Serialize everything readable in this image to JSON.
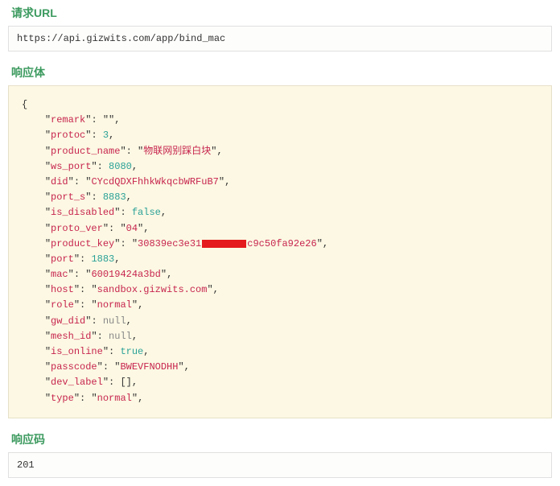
{
  "sections": {
    "request_url_title": "请求URL",
    "response_body_title": "响应体",
    "response_code_title": "响应码"
  },
  "request_url": "https://api.gizwits.com/app/bind_mac",
  "response_code": "201",
  "response_body": {
    "remark": "",
    "protoc": 3,
    "product_name": "物联网别踩白块",
    "ws_port": 8080,
    "did": "CYcdQDXFhhkWkqcbWRFuB7",
    "port_s": 8883,
    "is_disabled": false,
    "proto_ver": "04",
    "product_key_prefix": "30839ec3e31",
    "product_key_redacted": true,
    "product_key_suffix": "c9c50fa92e26",
    "port": 1883,
    "mac": "60019424a3bd",
    "host": "sandbox.gizwits.com",
    "role": "normal",
    "gw_did": null,
    "mesh_id": null,
    "is_online": true,
    "passcode": "BWEVFNODHH",
    "dev_label": [],
    "type": "normal"
  }
}
